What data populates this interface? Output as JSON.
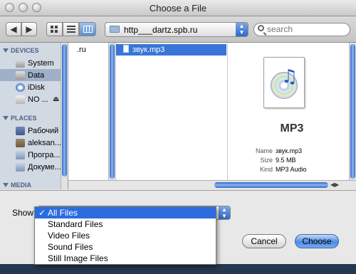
{
  "window": {
    "title": "Choose a File"
  },
  "toolbar": {
    "back": "◀",
    "forward": "▶",
    "path": "http___dartz.spb.ru",
    "search_placeholder": "search"
  },
  "sidebar": {
    "devices_header": "DEVICES",
    "places_header": "PLACES",
    "media_header": "MEDIA",
    "devices": [
      {
        "label": "System",
        "icon": "hard-drive-icon"
      },
      {
        "label": "Data",
        "icon": "hard-drive-icon",
        "selected": true
      },
      {
        "label": "iDisk",
        "icon": "idisk-icon"
      },
      {
        "label": "NO ...",
        "icon": "disk-icon",
        "eject": "⏏"
      }
    ],
    "places": [
      {
        "label": "Рабочий ...",
        "icon": "desktop-icon"
      },
      {
        "label": "aleksan...",
        "icon": "home-icon"
      },
      {
        "label": "Програ...",
        "icon": "applications-icon"
      },
      {
        "label": "Докуме...",
        "icon": "documents-icon"
      }
    ]
  },
  "browser": {
    "column1": [
      ".ru"
    ],
    "column2": [
      {
        "label": "звук.mp3",
        "icon": "audio-file-icon",
        "selected": true
      }
    ]
  },
  "preview": {
    "icon": "mp3-file-icon",
    "badge": "MP3",
    "name_key": "Name",
    "name": "звук.mp3",
    "size_key": "Size",
    "size": "9.5 MB",
    "kind_key": "Kind",
    "kind": "MP3 Audio"
  },
  "footer": {
    "show_label": "Show",
    "format_options": [
      "All Files",
      "Standard Files",
      "Video Files",
      "Sound Files",
      "Still Image Files"
    ],
    "selected_format": "All Files",
    "check": "✓",
    "cancel": "Cancel",
    "choose": "Choose"
  }
}
